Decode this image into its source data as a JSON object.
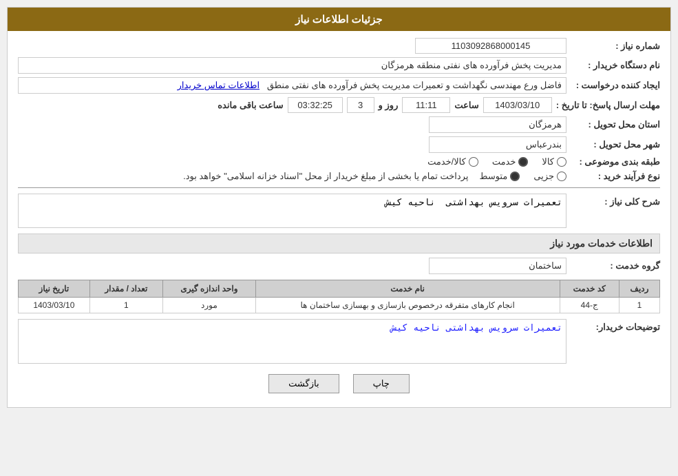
{
  "header": {
    "title": "جزئیات اطلاعات نیاز"
  },
  "fields": {
    "shomareNiaz_label": "شماره نیاز :",
    "shomareNiaz_value": "1103092868000145",
    "namDastgah_label": "نام دستگاه خریدار :",
    "namDastgah_value": "مدیریت پخش فرآورده های نفتی منطقه هرمزگان",
    "ijadKonande_label": "ایجاد کننده درخواست :",
    "ijadKonande_value": "فاضل ورع مهندسی نگهداشت و تعمیرات مدیریت پخش فرآورده های نفتی منطق",
    "ijadKonande_link": "اطلاعات تماس خریدار",
    "mohlat_label": "مهلت ارسال پاسخ: تا تاریخ :",
    "mohlat_date": "1403/03/10",
    "mohlat_saat_label": "ساعت",
    "mohlat_saat": "11:11",
    "mohlat_roz_label": "روز و",
    "mohlat_roz": "3",
    "mohlat_baqi_label": "ساعت باقی مانده",
    "mohlat_baqi": "03:32:25",
    "ostan_label": "استان محل تحویل :",
    "ostan_value": "هرمزگان",
    "shahr_label": "شهر محل تحویل :",
    "shahr_value": "بندرعباس",
    "tabaqe_label": "طبقه بندی موضوعی :",
    "tabaqe_options": [
      "کالا",
      "خدمت",
      "کالا/خدمت"
    ],
    "tabaqe_selected": "خدمت",
    "noefarayand_label": "نوع فرآیند خرید :",
    "noefarayand_options": [
      "جزیی",
      "متوسط"
    ],
    "noefarayand_selected": "متوسط",
    "noefarayand_text": "پرداخت تمام یا بخشی از مبلغ خریدار از محل \"اسناد خزانه اسلامی\" خواهد بود.",
    "sharhKolli_label": "شرح کلی نیاز :",
    "sharhKolli_value": "تعمیرات سرویس بهداشتی  ناحیه کیش",
    "khadamat_header": "اطلاعات خدمات مورد نیاز",
    "groheKhadamat_label": "گروه خدمت :",
    "groheKhadamat_value": "ساختمان",
    "table": {
      "headers": [
        "ردیف",
        "کد خدمت",
        "نام خدمت",
        "واحد اندازه گیری",
        "تعداد / مقدار",
        "تاریخ نیاز"
      ],
      "rows": [
        {
          "radif": "1",
          "kodKhadamat": "ج-44",
          "namKhadamat": "انجام کارهای متفرقه درخصوص بازسازی و بهسازی ساختمان ها",
          "vahed": "مورد",
          "tedad": "1",
          "tarikheNiaz": "1403/03/10"
        }
      ]
    },
    "tozihat_label": "توضیحات خریدار:",
    "tozihat_value": "تعمیرات سرویس بهداشتی ناحیه کیش"
  },
  "buttons": {
    "print_label": "چاپ",
    "back_label": "بازگشت"
  }
}
